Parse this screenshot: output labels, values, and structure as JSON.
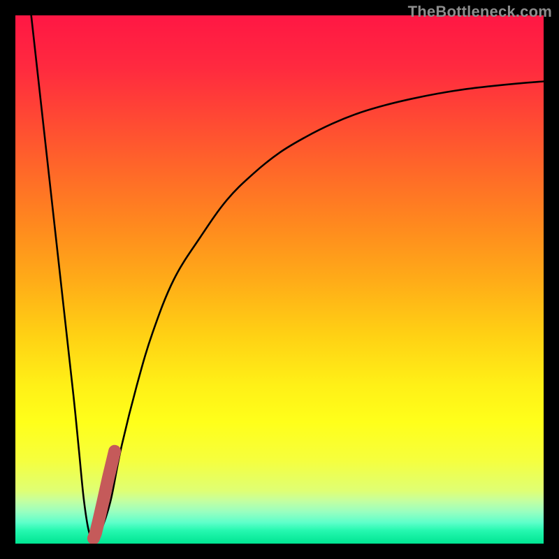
{
  "watermark": "TheBottleneck.com",
  "colors": {
    "frame": "#000000",
    "curve": "#000000",
    "marker": "#c55a5a",
    "gradient_stops": [
      {
        "offset": 0.0,
        "color": "#ff1744"
      },
      {
        "offset": 0.1,
        "color": "#ff2a3f"
      },
      {
        "offset": 0.2,
        "color": "#ff4a33"
      },
      {
        "offset": 0.3,
        "color": "#ff6a28"
      },
      {
        "offset": 0.4,
        "color": "#ff8a1e"
      },
      {
        "offset": 0.5,
        "color": "#ffab18"
      },
      {
        "offset": 0.6,
        "color": "#ffcf14"
      },
      {
        "offset": 0.7,
        "color": "#fff017"
      },
      {
        "offset": 0.77,
        "color": "#ffff1a"
      },
      {
        "offset": 0.84,
        "color": "#f6ff3c"
      },
      {
        "offset": 0.9,
        "color": "#dfff74"
      },
      {
        "offset": 0.92,
        "color": "#c2ffa2"
      },
      {
        "offset": 0.94,
        "color": "#98ffc0"
      },
      {
        "offset": 0.96,
        "color": "#5effca"
      },
      {
        "offset": 0.975,
        "color": "#26f8b0"
      },
      {
        "offset": 1.0,
        "color": "#00e592"
      }
    ]
  },
  "chart_data": {
    "type": "line",
    "title": "",
    "xlabel": "",
    "ylabel": "",
    "xlim": [
      0,
      100
    ],
    "ylim": [
      0,
      100
    ],
    "series": [
      {
        "name": "bottleneck-curve",
        "x": [
          3,
          5,
          7,
          9,
          11,
          12,
          13,
          14,
          15,
          16,
          18,
          20,
          23,
          26,
          30,
          35,
          40,
          45,
          50,
          55,
          60,
          65,
          70,
          75,
          80,
          85,
          90,
          95,
          100
        ],
        "y": [
          100,
          82,
          64,
          46,
          28,
          18,
          8,
          2,
          1,
          2,
          8,
          18,
          30,
          40,
          50,
          58,
          65,
          70,
          74,
          77,
          79.5,
          81.5,
          83,
          84.2,
          85.2,
          86,
          86.6,
          87.1,
          87.5
        ]
      }
    ],
    "marker_segment": {
      "name": "current-position",
      "x": [
        14.8,
        15.2,
        15.8,
        16.6,
        17.6,
        18.8
      ],
      "y": [
        1.0,
        2.0,
        4.5,
        8.0,
        12.5,
        17.5
      ]
    }
  }
}
